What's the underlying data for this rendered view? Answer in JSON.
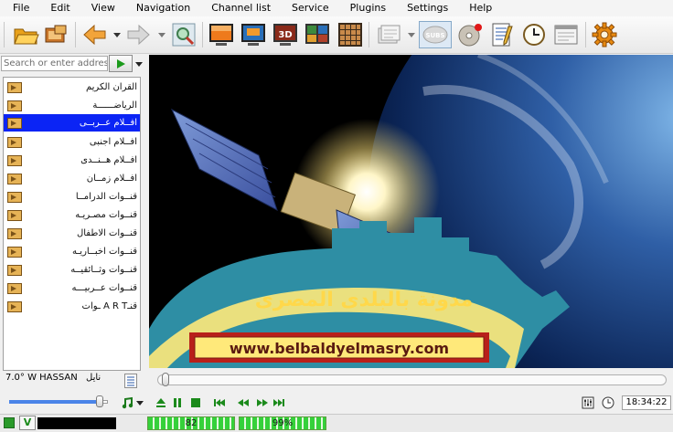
{
  "menu": [
    "File",
    "Edit",
    "View",
    "Navigation",
    "Channel list",
    "Service",
    "Plugins",
    "Settings",
    "Help"
  ],
  "toolbar_icons": [
    "open-folder-icon",
    "media-icon",
    "back-arrow-icon",
    "forward-arrow-icon",
    "scan-icon",
    "screen-orange-icon",
    "screen-blue-icon",
    "3d-icon",
    "mosaic-icon",
    "grid-icon",
    "subtitles-icon",
    "record-disc-icon",
    "notepad-icon",
    "clock-icon",
    "window-icon",
    "settings-gear-icon"
  ],
  "address": {
    "placeholder": "Search or enter address"
  },
  "channels": [
    {
      "label": "القران الكريم",
      "selected": false
    },
    {
      "label": "الرياضــــــة",
      "selected": false
    },
    {
      "label": "افــلام عــربــى",
      "selected": true
    },
    {
      "label": "افــلام اجنبى",
      "selected": false
    },
    {
      "label": "افــلام هــنــدى",
      "selected": false
    },
    {
      "label": "افــلام زمــان",
      "selected": false
    },
    {
      "label": "قنــوات الدرامــا",
      "selected": false
    },
    {
      "label": "قنــوات مصـريـه",
      "selected": false
    },
    {
      "label": "قنــوات الاطفال",
      "selected": false
    },
    {
      "label": "قنــوات اخبــاريـه",
      "selected": false
    },
    {
      "label": "قنــوات وثــائقيــه",
      "selected": false
    },
    {
      "label": "قنــوات عــربيـــه",
      "selected": false
    },
    {
      "label": "قنـA R T ـوات",
      "selected": false
    }
  ],
  "video": {
    "banner_text": "مدونة بالبلدى المصرى",
    "url_text": "www.belbaldyelmasry.com"
  },
  "satellite": {
    "position": "7.0° W HASSAN",
    "name_ar": "نايل"
  },
  "time": "18:34:22",
  "status": {
    "signal": "82",
    "quality": "99%",
    "signal_fraction": 0.82,
    "quality_fraction": 0.99
  },
  "volume_fraction": 0.92,
  "colors": {
    "selection": "#0b24f5",
    "banner_teal": "#2e8ea4",
    "banner_text": "#ffd84a",
    "url_box": "#ffe97a",
    "url_border": "#b8201a",
    "meter_green": "#35d13a"
  }
}
